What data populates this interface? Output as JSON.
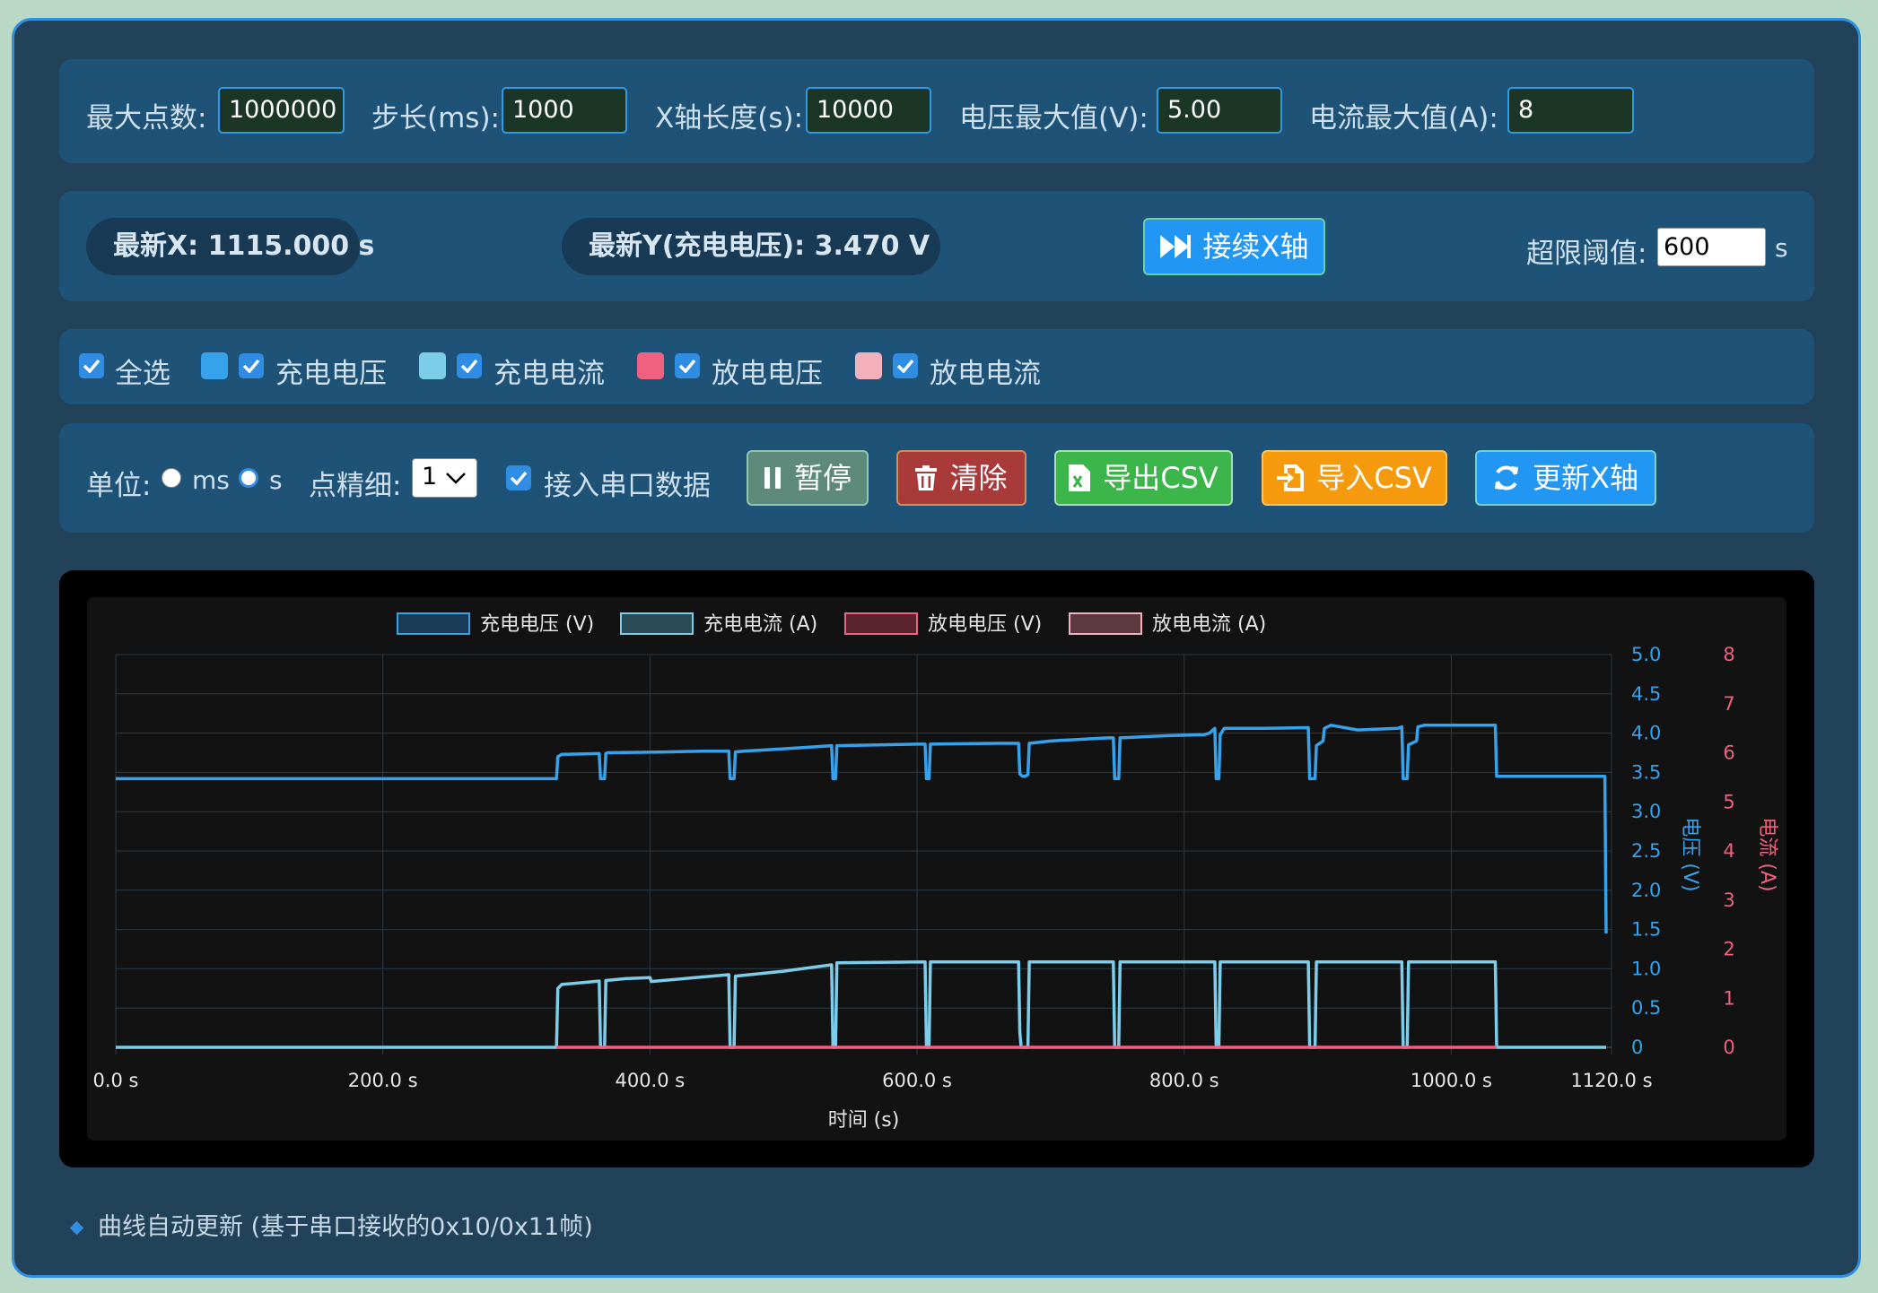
{
  "settings": {
    "max_points_label": "最大点数:",
    "max_points_value": "1000000",
    "step_label": "步长(ms):",
    "step_value": "1000",
    "xlen_label": "X轴长度(s):",
    "xlen_value": "10000",
    "vmax_label": "电压最大值(V):",
    "vmax_value": "5.00",
    "imax_label": "电流最大值(A):",
    "imax_value": "8"
  },
  "status": {
    "latest_x": "最新X: 1115.000 s",
    "latest_y": "最新Y(充电电压): 3.470 V",
    "continue_button": "接续X轴",
    "threshold_label": "超限阈值:",
    "threshold_value": "600",
    "threshold_unit": "s"
  },
  "series_toggles": {
    "select_all": "全选",
    "items": [
      {
        "label": "充电电压",
        "color": "#36a2eb",
        "checked": true
      },
      {
        "label": "充电电流",
        "color": "#7ccdea",
        "checked": true
      },
      {
        "label": "放电电压",
        "color": "#f0607f",
        "checked": true
      },
      {
        "label": "放电电流",
        "color": "#f4b0bd",
        "checked": true
      }
    ]
  },
  "controls": {
    "unit_label": "单位:",
    "unit_ms": "ms",
    "unit_s": "s",
    "unit_selected": "s",
    "precision_label": "点精细:",
    "precision_value": "1",
    "serial_label": "接入串口数据",
    "pause_button": "暂停",
    "clear_button": "清除",
    "export_button": "导出CSV",
    "import_button": "导入CSV",
    "update_button": "更新X轴"
  },
  "chart_data": {
    "type": "line",
    "xlabel": "时间 (s)",
    "ylabel_left": "电压 (V)",
    "ylabel_right": "电流 (A)",
    "x_ticks": [
      "0.0 s",
      "200.0 s",
      "400.0 s",
      "600.0 s",
      "800.0 s",
      "1000.0 s",
      "1120.0 s"
    ],
    "xlim": [
      0,
      1120
    ],
    "ylim_left": [
      0,
      5
    ],
    "ylim_right": [
      0,
      8
    ],
    "left_ticks": [
      "0",
      "0.5",
      "1.0",
      "1.5",
      "2.0",
      "2.5",
      "3.0",
      "3.5",
      "4.0",
      "4.5",
      "5.0"
    ],
    "right_ticks": [
      "0",
      "1",
      "2",
      "3",
      "4",
      "5",
      "6",
      "7",
      "8"
    ],
    "legend_position": "top",
    "grid": true,
    "series": [
      {
        "name": "充电电压 (V)",
        "color": "#36a2eb",
        "axis": "left",
        "points": [
          [
            0,
            3.42
          ],
          [
            330,
            3.42
          ],
          [
            331,
            3.7
          ],
          [
            334,
            3.73
          ],
          [
            362,
            3.74
          ],
          [
            363,
            3.42
          ],
          [
            366,
            3.42
          ],
          [
            367,
            3.74
          ],
          [
            368,
            3.75
          ],
          [
            412,
            3.76
          ],
          [
            440,
            3.77
          ],
          [
            459,
            3.77
          ],
          [
            460,
            3.42
          ],
          [
            463,
            3.42
          ],
          [
            464,
            3.76
          ],
          [
            470,
            3.77
          ],
          [
            500,
            3.8
          ],
          [
            536,
            3.84
          ],
          [
            537,
            3.42
          ],
          [
            539,
            3.42
          ],
          [
            540,
            3.84
          ],
          [
            600,
            3.86
          ],
          [
            606,
            3.86
          ],
          [
            607,
            3.42
          ],
          [
            609,
            3.42
          ],
          [
            610,
            3.86
          ],
          [
            660,
            3.87
          ],
          [
            676,
            3.87
          ],
          [
            677,
            3.48
          ],
          [
            679,
            3.45
          ],
          [
            681,
            3.45
          ],
          [
            683,
            3.47
          ],
          [
            684,
            3.87
          ],
          [
            700,
            3.9
          ],
          [
            710,
            3.91
          ],
          [
            743,
            3.94
          ],
          [
            747,
            3.94
          ],
          [
            748,
            3.42
          ],
          [
            751,
            3.42
          ],
          [
            752,
            3.94
          ],
          [
            790,
            3.97
          ],
          [
            815,
            3.98
          ],
          [
            819,
            4.0
          ],
          [
            823,
            4.06
          ],
          [
            824,
            3.42
          ],
          [
            826,
            3.42
          ],
          [
            827,
            3.98
          ],
          [
            830,
            4.06
          ],
          [
            860,
            4.06
          ],
          [
            893,
            4.07
          ],
          [
            894,
            3.42
          ],
          [
            898,
            3.42
          ],
          [
            899,
            3.84
          ],
          [
            904,
            3.9
          ],
          [
            905,
            4.06
          ],
          [
            910,
            4.1
          ],
          [
            930,
            4.04
          ],
          [
            960,
            4.06
          ],
          [
            963,
            4.08
          ],
          [
            964,
            3.42
          ],
          [
            967,
            3.42
          ],
          [
            968,
            3.85
          ],
          [
            974,
            3.9
          ],
          [
            975,
            4.08
          ],
          [
            980,
            4.1
          ],
          [
            1033,
            4.1
          ],
          [
            1034,
            3.45
          ],
          [
            1115,
            3.45
          ],
          [
            1116,
            1.45
          ]
        ]
      },
      {
        "name": "充电电流 (A)",
        "color": "#7ccdea",
        "axis": "right",
        "points": [
          [
            0,
            0
          ],
          [
            330,
            0
          ],
          [
            331,
            1.2
          ],
          [
            334,
            1.28
          ],
          [
            362,
            1.35
          ],
          [
            363,
            0
          ],
          [
            366,
            0
          ],
          [
            367,
            1.36
          ],
          [
            382,
            1.4
          ],
          [
            400,
            1.42
          ],
          [
            401,
            1.34
          ],
          [
            459,
            1.48
          ],
          [
            460,
            0
          ],
          [
            463,
            0
          ],
          [
            464,
            1.45
          ],
          [
            500,
            1.55
          ],
          [
            536,
            1.68
          ],
          [
            537,
            0
          ],
          [
            539,
            0
          ],
          [
            540,
            1.72
          ],
          [
            606,
            1.74
          ],
          [
            607,
            0
          ],
          [
            609,
            0
          ],
          [
            610,
            1.74
          ],
          [
            676,
            1.74
          ],
          [
            677,
            0.3
          ],
          [
            678,
            0
          ],
          [
            683,
            0
          ],
          [
            684,
            1.74
          ],
          [
            747,
            1.74
          ],
          [
            748,
            0
          ],
          [
            751,
            0
          ],
          [
            752,
            1.74
          ],
          [
            823,
            1.74
          ],
          [
            824,
            0
          ],
          [
            826,
            0
          ],
          [
            827,
            1.74
          ],
          [
            893,
            1.74
          ],
          [
            894,
            0
          ],
          [
            898,
            0
          ],
          [
            899,
            1.74
          ],
          [
            963,
            1.74
          ],
          [
            964,
            0
          ],
          [
            967,
            0
          ],
          [
            968,
            1.74
          ],
          [
            1033,
            1.74
          ],
          [
            1034,
            0
          ],
          [
            1116,
            0
          ]
        ]
      },
      {
        "name": "放电电压 (V)",
        "color": "#f0607f",
        "axis": "left",
        "points": [
          [
            330,
            0
          ],
          [
            1034,
            0
          ]
        ]
      },
      {
        "name": "放电电流 (A)",
        "color": "#f4b0bd",
        "axis": "right",
        "points": []
      }
    ]
  },
  "footer": {
    "text": "曲线自动更新 (基于串口接收的0x10/0x11帧)"
  }
}
